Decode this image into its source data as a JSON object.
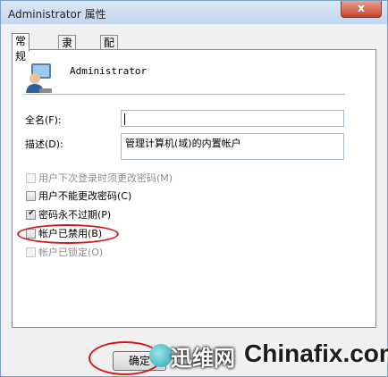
{
  "window": {
    "title": "Administrator 属性",
    "close_label": "x"
  },
  "tabs": [
    {
      "label": "常规",
      "active": true
    },
    {
      "label": "隶属于",
      "active": false
    },
    {
      "label": "配置文件",
      "active": false
    }
  ],
  "user": {
    "name": "Administrator"
  },
  "form": {
    "fullname_label": "全名(F):",
    "fullname_value": "",
    "description_label": "描述(D):",
    "description_value": "管理计算机(域)的内置帐户"
  },
  "checkboxes": [
    {
      "label": "用户下次登录时须更改密码(M)",
      "checked": false,
      "enabled": false
    },
    {
      "label": "用户不能更改密码(C)",
      "checked": false,
      "enabled": true
    },
    {
      "label": "密码永不过期(P)",
      "checked": true,
      "enabled": true
    },
    {
      "label": "帐户已禁用(B)",
      "checked": false,
      "enabled": true
    },
    {
      "label": "帐户已锁定(O)",
      "checked": false,
      "enabled": false
    }
  ],
  "buttons": {
    "ok_label": "确定"
  },
  "watermark": {
    "cn_text": "迅维网",
    "en_text": "Chinafix.com"
  },
  "colors": {
    "highlight_ring": "#d01818",
    "titlebar": "#c3d6ee"
  }
}
